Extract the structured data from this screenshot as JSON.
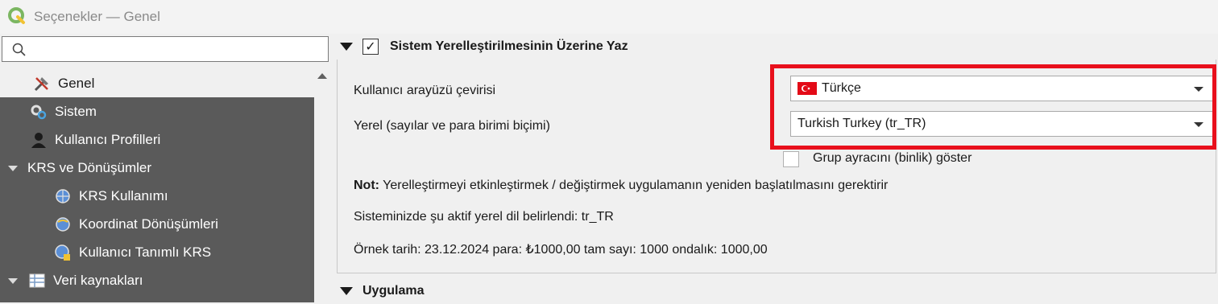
{
  "window": {
    "title": "Seçenekler — Genel"
  },
  "search": {
    "placeholder": "",
    "value": ""
  },
  "sidebar": {
    "items": [
      {
        "label": "Genel",
        "icon": "hammer-wrench-icon",
        "selected": true
      },
      {
        "label": "Sistem",
        "icon": "system-gears-icon"
      },
      {
        "label": "Kullanıcı Profilleri",
        "icon": "user-profile-icon"
      },
      {
        "label": "KRS ve Dönüşümler",
        "expanded": true
      },
      {
        "label": "KRS Kullanımı",
        "icon": "globe-icon"
      },
      {
        "label": "Koordinat Dönüşümleri",
        "icon": "globe-transform-icon"
      },
      {
        "label": "Kullanıcı Tanımlı KRS",
        "icon": "globe-user-icon"
      },
      {
        "label": "Veri kaynakları",
        "icon": "table-icon",
        "expanded": true
      }
    ]
  },
  "locale_group": {
    "title": "Sistem Yerelleştirilmesinin Üzerine Yaz",
    "checked": true,
    "ui_translation_label": "Kullanıcı arayüzü çevirisi",
    "ui_translation_value": "Türkçe",
    "locale_label": "Yerel (sayılar ve para birimi biçimi)",
    "locale_value": "Turkish Turkey (tr_TR)",
    "group_separator_label": "Grup ayracını (binlik) göster",
    "group_separator_checked": false,
    "note_bold": "Not:",
    "note_text": " Yerelleştirmeyi etkinleştirmek / değiştirmek uygulamanın yeniden başlatılmasını gerektirir",
    "detected_locale": "Sisteminizde şu aktif yerel dil belirlendi: tr_TR",
    "sample": "Örnek tarih: 23.12.2024 para: ₺1000,00 tam sayı: 1000 ondalık: 1000,00"
  },
  "app_group": {
    "title": "Uygulama"
  },
  "colors": {
    "highlight": "#e8101c",
    "sidebar_bg": "#5a5a5a"
  }
}
